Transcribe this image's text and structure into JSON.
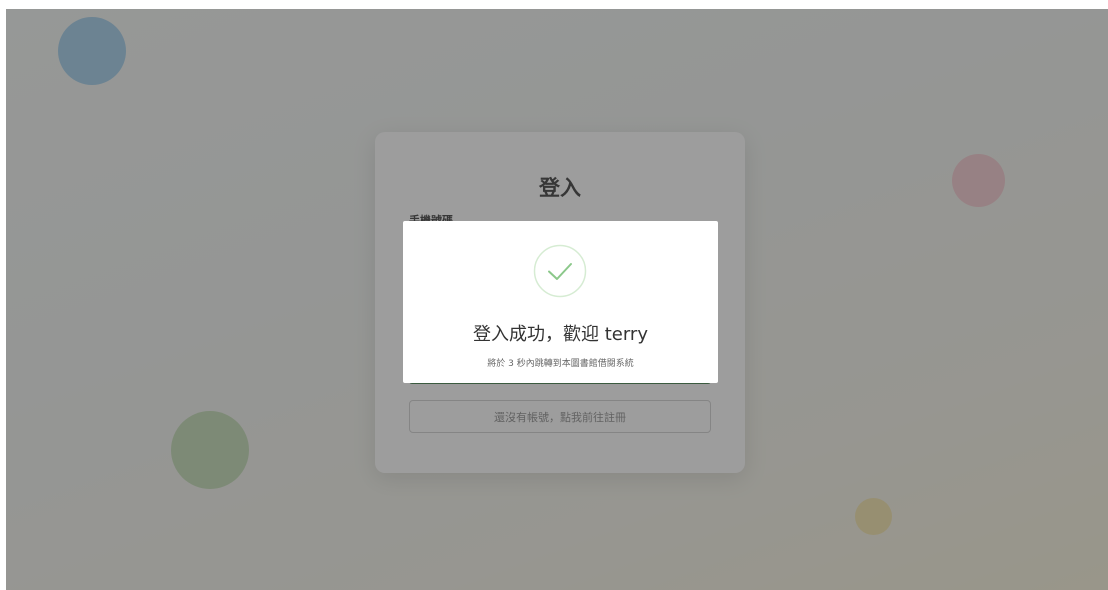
{
  "login_form": {
    "title": "登入",
    "phone_label": "手機號碼",
    "register_link": "還沒有帳號，點我前往註冊"
  },
  "success_dialog": {
    "icon": "check-circle-icon",
    "title": "登入成功，歡迎 terry",
    "subtitle": "將於 3 秒內跳轉到本圖書館借閱系統"
  },
  "colors": {
    "success_green": "#8bc88a",
    "primary_button": "#3b7a45"
  }
}
